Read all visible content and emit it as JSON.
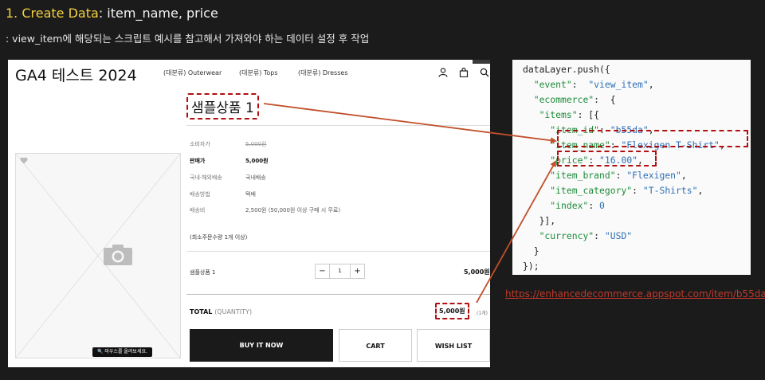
{
  "heading": {
    "number": "1. Create Data",
    "sep": ": ",
    "text": "item_name, price"
  },
  "subheading": ": view_item에 해당되는 스크립트 예시를 참고해서 가져와야 하는 데이터 설정 후 작업",
  "shop": {
    "logo": "GA4 테스트 2024",
    "nav": [
      "(대분류) Outerwear",
      "(대분류) Tops",
      "(대분류) Dresses"
    ],
    "icons": [
      "user-icon",
      "bag-icon",
      "search-icon"
    ],
    "product_title": "샘플상품 1",
    "zoom_hint": "마우스를 올려보세요.",
    "info": [
      {
        "label": "소비자가",
        "value": "5,000원"
      },
      {
        "label": "판매가",
        "value": "5,000원"
      },
      {
        "label": "국내·해외배송",
        "value": "국내배송"
      },
      {
        "label": "배송방법",
        "value": "택배"
      },
      {
        "label": "배송비",
        "value": "2,500원 (50,000원 이상 구매 시 무료)"
      }
    ],
    "min_qty": "(최소주문수량 1개 이상)",
    "option": {
      "name": "샘플상품 1",
      "minus": "−",
      "qty": "1",
      "plus": "+",
      "price": "5,000원"
    },
    "total": {
      "label": "TOTAL",
      "qty_label": "(QUANTITY)",
      "price": "5,000원",
      "count": "(1개)"
    },
    "buttons": {
      "buy": "BUY IT NOW",
      "cart": "CART",
      "wish": "WISH LIST"
    }
  },
  "code": {
    "lines": [
      [
        [
          "fn",
          "dataLayer.push({"
        ]
      ],
      [
        [
          "pun",
          "  "
        ],
        [
          "key",
          "\"event\""
        ],
        [
          "pun",
          ":  "
        ],
        [
          "str",
          "\"view_item\""
        ],
        [
          "pun",
          ","
        ]
      ],
      [
        [
          "pun",
          "  "
        ],
        [
          "key",
          "\"ecommerce\""
        ],
        [
          "pun",
          ":  {"
        ]
      ],
      [
        [
          "pun",
          "   "
        ],
        [
          "key",
          "\"items\""
        ],
        [
          "pun",
          ": [{"
        ]
      ],
      [
        [
          "pun",
          "     "
        ],
        [
          "key",
          "\"item_id\""
        ],
        [
          "pun",
          ": "
        ],
        [
          "str",
          "\"b55da\""
        ],
        [
          "pun",
          ","
        ]
      ],
      [
        [
          "pun",
          "     "
        ],
        [
          "key",
          "\"item_name\""
        ],
        [
          "pun",
          ": "
        ],
        [
          "str",
          "\"Flexigen T-Shirt\""
        ],
        [
          "pun",
          ","
        ]
      ],
      [
        [
          "pun",
          "     "
        ],
        [
          "key",
          "\"price\""
        ],
        [
          "pun",
          ": "
        ],
        [
          "str",
          "\"16.00\""
        ],
        [
          "pun",
          ","
        ]
      ],
      [
        [
          "pun",
          "     "
        ],
        [
          "key",
          "\"item_brand\""
        ],
        [
          "pun",
          ": "
        ],
        [
          "str",
          "\"Flexigen\""
        ],
        [
          "pun",
          ","
        ]
      ],
      [
        [
          "pun",
          "     "
        ],
        [
          "key",
          "\"item_category\""
        ],
        [
          "pun",
          ": "
        ],
        [
          "str",
          "\"T-Shirts\""
        ],
        [
          "pun",
          ","
        ]
      ],
      [
        [
          "pun",
          "     "
        ],
        [
          "key",
          "\"index\""
        ],
        [
          "pun",
          ": "
        ],
        [
          "num",
          "0"
        ]
      ],
      [
        [
          "pun",
          "   }],"
        ]
      ],
      [
        [
          "pun",
          "   "
        ],
        [
          "key",
          "\"currency\""
        ],
        [
          "pun",
          ": "
        ],
        [
          "str",
          "\"USD\""
        ]
      ],
      [
        [
          "pun",
          "  }"
        ]
      ],
      [
        [
          "pun",
          "});"
        ]
      ]
    ]
  },
  "source_link": "https://enhancedecommerce.appspot.com/item/b55da",
  "colors": {
    "highlight": "#b01010",
    "arrow": "#c0502a",
    "heading_number": "#f4d03f",
    "link": "#c0392b"
  }
}
